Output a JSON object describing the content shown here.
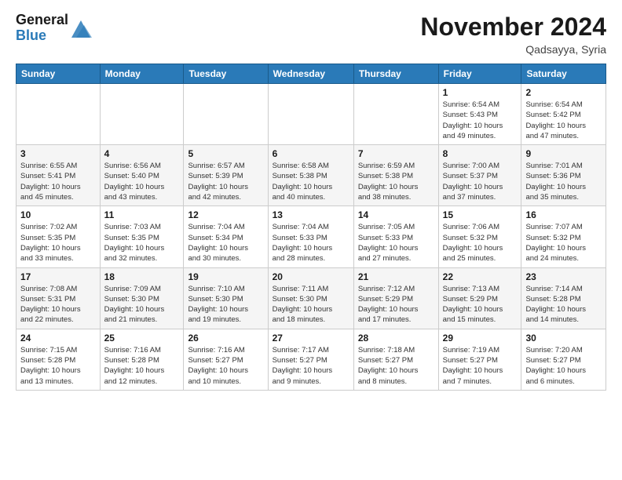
{
  "header": {
    "logo_general": "General",
    "logo_blue": "Blue",
    "month_title": "November 2024",
    "location": "Qadsayya, Syria"
  },
  "weekdays": [
    "Sunday",
    "Monday",
    "Tuesday",
    "Wednesday",
    "Thursday",
    "Friday",
    "Saturday"
  ],
  "weeks": [
    [
      {
        "day": "",
        "info": ""
      },
      {
        "day": "",
        "info": ""
      },
      {
        "day": "",
        "info": ""
      },
      {
        "day": "",
        "info": ""
      },
      {
        "day": "",
        "info": ""
      },
      {
        "day": "1",
        "info": "Sunrise: 6:54 AM\nSunset: 5:43 PM\nDaylight: 10 hours\nand 49 minutes."
      },
      {
        "day": "2",
        "info": "Sunrise: 6:54 AM\nSunset: 5:42 PM\nDaylight: 10 hours\nand 47 minutes."
      }
    ],
    [
      {
        "day": "3",
        "info": "Sunrise: 6:55 AM\nSunset: 5:41 PM\nDaylight: 10 hours\nand 45 minutes."
      },
      {
        "day": "4",
        "info": "Sunrise: 6:56 AM\nSunset: 5:40 PM\nDaylight: 10 hours\nand 43 minutes."
      },
      {
        "day": "5",
        "info": "Sunrise: 6:57 AM\nSunset: 5:39 PM\nDaylight: 10 hours\nand 42 minutes."
      },
      {
        "day": "6",
        "info": "Sunrise: 6:58 AM\nSunset: 5:38 PM\nDaylight: 10 hours\nand 40 minutes."
      },
      {
        "day": "7",
        "info": "Sunrise: 6:59 AM\nSunset: 5:38 PM\nDaylight: 10 hours\nand 38 minutes."
      },
      {
        "day": "8",
        "info": "Sunrise: 7:00 AM\nSunset: 5:37 PM\nDaylight: 10 hours\nand 37 minutes."
      },
      {
        "day": "9",
        "info": "Sunrise: 7:01 AM\nSunset: 5:36 PM\nDaylight: 10 hours\nand 35 minutes."
      }
    ],
    [
      {
        "day": "10",
        "info": "Sunrise: 7:02 AM\nSunset: 5:35 PM\nDaylight: 10 hours\nand 33 minutes."
      },
      {
        "day": "11",
        "info": "Sunrise: 7:03 AM\nSunset: 5:35 PM\nDaylight: 10 hours\nand 32 minutes."
      },
      {
        "day": "12",
        "info": "Sunrise: 7:04 AM\nSunset: 5:34 PM\nDaylight: 10 hours\nand 30 minutes."
      },
      {
        "day": "13",
        "info": "Sunrise: 7:04 AM\nSunset: 5:33 PM\nDaylight: 10 hours\nand 28 minutes."
      },
      {
        "day": "14",
        "info": "Sunrise: 7:05 AM\nSunset: 5:33 PM\nDaylight: 10 hours\nand 27 minutes."
      },
      {
        "day": "15",
        "info": "Sunrise: 7:06 AM\nSunset: 5:32 PM\nDaylight: 10 hours\nand 25 minutes."
      },
      {
        "day": "16",
        "info": "Sunrise: 7:07 AM\nSunset: 5:32 PM\nDaylight: 10 hours\nand 24 minutes."
      }
    ],
    [
      {
        "day": "17",
        "info": "Sunrise: 7:08 AM\nSunset: 5:31 PM\nDaylight: 10 hours\nand 22 minutes."
      },
      {
        "day": "18",
        "info": "Sunrise: 7:09 AM\nSunset: 5:30 PM\nDaylight: 10 hours\nand 21 minutes."
      },
      {
        "day": "19",
        "info": "Sunrise: 7:10 AM\nSunset: 5:30 PM\nDaylight: 10 hours\nand 19 minutes."
      },
      {
        "day": "20",
        "info": "Sunrise: 7:11 AM\nSunset: 5:30 PM\nDaylight: 10 hours\nand 18 minutes."
      },
      {
        "day": "21",
        "info": "Sunrise: 7:12 AM\nSunset: 5:29 PM\nDaylight: 10 hours\nand 17 minutes."
      },
      {
        "day": "22",
        "info": "Sunrise: 7:13 AM\nSunset: 5:29 PM\nDaylight: 10 hours\nand 15 minutes."
      },
      {
        "day": "23",
        "info": "Sunrise: 7:14 AM\nSunset: 5:28 PM\nDaylight: 10 hours\nand 14 minutes."
      }
    ],
    [
      {
        "day": "24",
        "info": "Sunrise: 7:15 AM\nSunset: 5:28 PM\nDaylight: 10 hours\nand 13 minutes."
      },
      {
        "day": "25",
        "info": "Sunrise: 7:16 AM\nSunset: 5:28 PM\nDaylight: 10 hours\nand 12 minutes."
      },
      {
        "day": "26",
        "info": "Sunrise: 7:16 AM\nSunset: 5:27 PM\nDaylight: 10 hours\nand 10 minutes."
      },
      {
        "day": "27",
        "info": "Sunrise: 7:17 AM\nSunset: 5:27 PM\nDaylight: 10 hours\nand 9 minutes."
      },
      {
        "day": "28",
        "info": "Sunrise: 7:18 AM\nSunset: 5:27 PM\nDaylight: 10 hours\nand 8 minutes."
      },
      {
        "day": "29",
        "info": "Sunrise: 7:19 AM\nSunset: 5:27 PM\nDaylight: 10 hours\nand 7 minutes."
      },
      {
        "day": "30",
        "info": "Sunrise: 7:20 AM\nSunset: 5:27 PM\nDaylight: 10 hours\nand 6 minutes."
      }
    ]
  ]
}
